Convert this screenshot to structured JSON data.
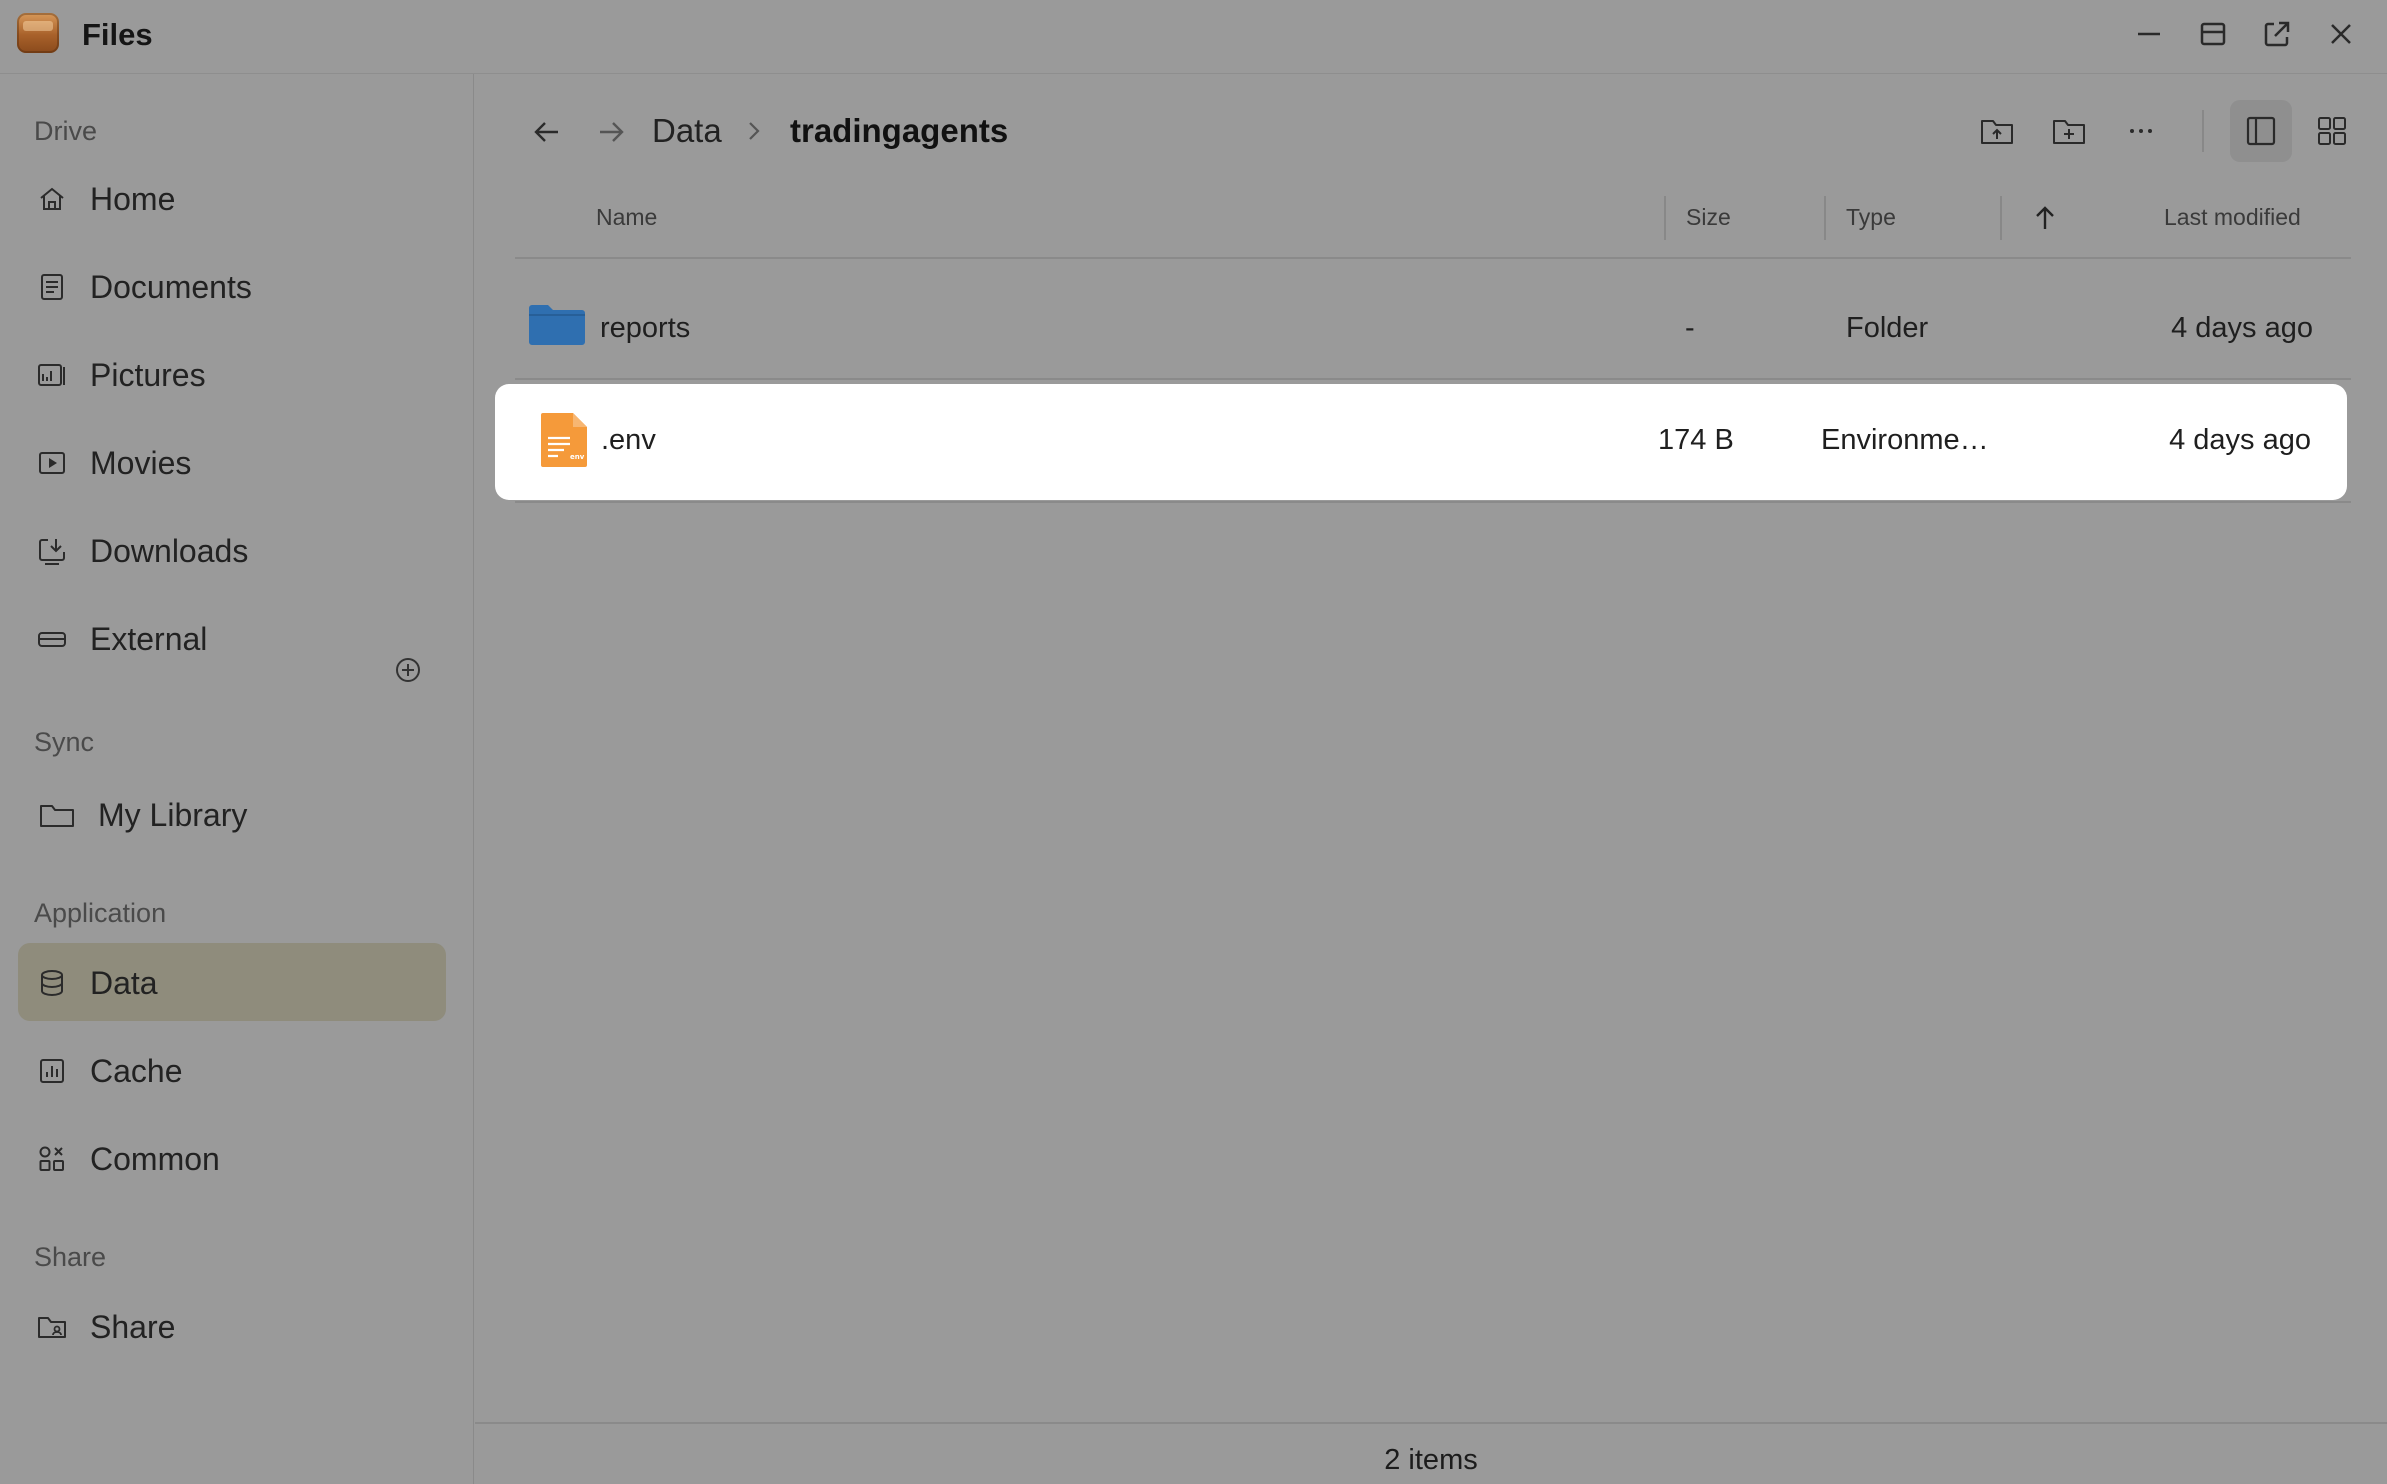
{
  "app": {
    "title": "Files"
  },
  "sidebar": {
    "sections": {
      "drive": "Drive",
      "sync": "Sync",
      "application": "Application",
      "share": "Share"
    },
    "drive_items": [
      {
        "label": "Home",
        "icon": "home-icon"
      },
      {
        "label": "Documents",
        "icon": "document-icon"
      },
      {
        "label": "Pictures",
        "icon": "pictures-icon"
      },
      {
        "label": "Movies",
        "icon": "movie-icon"
      },
      {
        "label": "Downloads",
        "icon": "download-icon"
      },
      {
        "label": "External",
        "icon": "drive-icon"
      }
    ],
    "sync_items": [
      {
        "label": "My Library",
        "icon": "folder-icon"
      }
    ],
    "application_items": [
      {
        "label": "Data",
        "icon": "database-icon",
        "active": true
      },
      {
        "label": "Cache",
        "icon": "chart-icon"
      },
      {
        "label": "Common",
        "icon": "apps-icon"
      }
    ],
    "share_items": [
      {
        "label": "Share",
        "icon": "shared-folder-icon"
      }
    ]
  },
  "breadcrumb": [
    "Data",
    "tradingagents"
  ],
  "table": {
    "columns": {
      "name": "Name",
      "size": "Size",
      "type": "Type",
      "modified": "Last modified"
    },
    "sort": "ascending",
    "rows": [
      {
        "name": "reports",
        "size": "-",
        "type": "Folder",
        "modified": "4 days ago",
        "icon": "folder-icon",
        "selected": false
      },
      {
        "name": ".env",
        "size": "174 B",
        "type": "Environme…",
        "modified": "4 days ago",
        "icon": "env-file-icon",
        "selected": true
      }
    ]
  },
  "status": {
    "item_count": "2 items"
  },
  "colors": {
    "overlay_background": "#9a9a9a",
    "active_sidebar": "#8f8c7c",
    "folder_blue": "#2f6fb0",
    "file_orange": "#f59a3a",
    "selected_row": "#ffffff"
  }
}
